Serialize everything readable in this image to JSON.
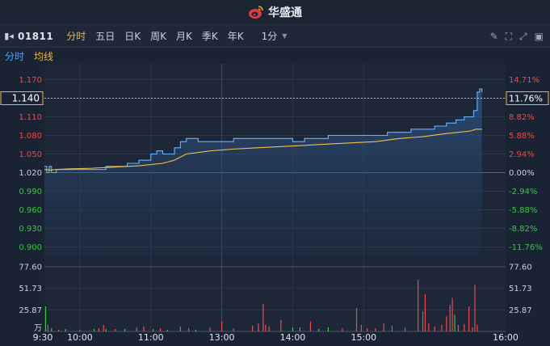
{
  "app": {
    "brand": "华盛通"
  },
  "toolbar": {
    "code": "01811",
    "tabs": [
      "分时",
      "五日",
      "日K",
      "周K",
      "月K",
      "季K",
      "年K"
    ],
    "active_tab": "分时",
    "period": "1分"
  },
  "subbar": {
    "timeshare": "分时",
    "avg_line": "均线"
  },
  "colors": {
    "up": "#e84c4c",
    "down": "#3ec24a",
    "price_line": "#69b4ff",
    "avg_line": "#f0c24b",
    "accent": "#f0b53f"
  },
  "chart_data": {
    "type": "line",
    "title": "",
    "current_price_label": "1.140",
    "current_pct_label": "11.76%",
    "prev_close": 1.02,
    "price_ticks": [
      "1.170",
      "1.140",
      "1.110",
      "1.080",
      "1.050",
      "1.020",
      "0.990",
      "0.960",
      "0.930",
      "0.900"
    ],
    "pct_ticks": [
      "14.71%",
      "11.76%",
      "8.82%",
      "5.88%",
      "2.94%",
      "0.00%",
      "-2.94%",
      "-5.88%",
      "-8.82%",
      "-11.76%"
    ],
    "volume_ticks": [
      "77.60",
      "51.73",
      "25.87"
    ],
    "volume_unit": "万",
    "time_ticks": [
      "9:30",
      "10:00",
      "11:00",
      "13:00",
      "14:00",
      "15:00",
      "16:00"
    ],
    "ylim": [
      0.885,
      1.185
    ],
    "price_series": {
      "name": "分时",
      "t": [
        0,
        2,
        4,
        6,
        10,
        15,
        20,
        30,
        40,
        50,
        52,
        60,
        66,
        70,
        80,
        90,
        95,
        100,
        110,
        115,
        120,
        130,
        140,
        150,
        160,
        170,
        185,
        195,
        205,
        210,
        220,
        240,
        250,
        260,
        270,
        280,
        290,
        300,
        310,
        320,
        330,
        335,
        340,
        348,
        355,
        360,
        363,
        366,
        368,
        370
      ],
      "values": [
        1.03,
        1.02,
        1.03,
        1.02,
        1.025,
        1.025,
        1.025,
        1.025,
        1.025,
        1.025,
        1.03,
        1.03,
        1.03,
        1.035,
        1.04,
        1.05,
        1.055,
        1.05,
        1.06,
        1.07,
        1.075,
        1.07,
        1.07,
        1.07,
        1.075,
        1.075,
        1.075,
        1.075,
        1.075,
        1.07,
        1.075,
        1.08,
        1.08,
        1.08,
        1.08,
        1.08,
        1.085,
        1.085,
        1.09,
        1.09,
        1.095,
        1.095,
        1.1,
        1.105,
        1.11,
        1.11,
        1.12,
        1.15,
        1.155,
        1.15
      ]
    },
    "avg_series": {
      "name": "均线",
      "t": [
        0,
        5,
        10,
        20,
        40,
        60,
        80,
        100,
        110,
        120,
        140,
        160,
        180,
        200,
        220,
        240,
        260,
        280,
        300,
        320,
        340,
        360,
        365,
        370
      ],
      "values": [
        1.025,
        1.024,
        1.025,
        1.026,
        1.027,
        1.029,
        1.031,
        1.035,
        1.04,
        1.05,
        1.055,
        1.058,
        1.06,
        1.062,
        1.064,
        1.066,
        1.068,
        1.07,
        1.075,
        1.078,
        1.083,
        1.087,
        1.09,
        1.09
      ]
    },
    "volume_max": 77.6,
    "volume_bars": [
      {
        "t": 1,
        "v": 30,
        "up": false
      },
      {
        "t": 3,
        "v": 8,
        "up": true
      },
      {
        "t": 6,
        "v": 4,
        "up": false
      },
      {
        "t": 12,
        "v": 2,
        "up": true
      },
      {
        "t": 18,
        "v": 3,
        "up": false
      },
      {
        "t": 30,
        "v": 2,
        "up": true
      },
      {
        "t": 42,
        "v": 3,
        "up": false
      },
      {
        "t": 46,
        "v": 4,
        "up": true
      },
      {
        "t": 50,
        "v": 8,
        "up": true
      },
      {
        "t": 52,
        "v": 3,
        "up": false
      },
      {
        "t": 60,
        "v": 3,
        "up": true
      },
      {
        "t": 68,
        "v": 3,
        "up": false
      },
      {
        "t": 78,
        "v": 5,
        "up": true
      },
      {
        "t": 84,
        "v": 6,
        "up": true
      },
      {
        "t": 92,
        "v": 3,
        "up": false
      },
      {
        "t": 98,
        "v": 4,
        "up": true
      },
      {
        "t": 104,
        "v": 2,
        "up": false
      },
      {
        "t": 115,
        "v": 6,
        "up": true
      },
      {
        "t": 122,
        "v": 4,
        "up": true
      },
      {
        "t": 128,
        "v": 2,
        "up": false
      },
      {
        "t": 140,
        "v": 5,
        "up": true
      },
      {
        "t": 150,
        "v": 12,
        "up": true
      },
      {
        "t": 160,
        "v": 4,
        "up": true
      },
      {
        "t": 176,
        "v": 7,
        "up": true
      },
      {
        "t": 181,
        "v": 10,
        "up": true
      },
      {
        "t": 185,
        "v": 33,
        "up": true
      },
      {
        "t": 187,
        "v": 8,
        "up": true
      },
      {
        "t": 190,
        "v": 6,
        "up": true
      },
      {
        "t": 200,
        "v": 14,
        "up": true
      },
      {
        "t": 210,
        "v": 5,
        "up": false
      },
      {
        "t": 216,
        "v": 5,
        "up": false
      },
      {
        "t": 225,
        "v": 12,
        "up": true
      },
      {
        "t": 232,
        "v": 3,
        "up": false
      },
      {
        "t": 240,
        "v": 5,
        "up": false
      },
      {
        "t": 252,
        "v": 4,
        "up": true
      },
      {
        "t": 264,
        "v": 28,
        "up": true
      },
      {
        "t": 268,
        "v": 8,
        "up": true
      },
      {
        "t": 273,
        "v": 4,
        "up": true
      },
      {
        "t": 280,
        "v": 4,
        "up": true
      },
      {
        "t": 287,
        "v": 10,
        "up": true
      },
      {
        "t": 294,
        "v": 7,
        "up": true
      },
      {
        "t": 305,
        "v": 5,
        "up": true
      },
      {
        "t": 316,
        "v": 62,
        "up": true
      },
      {
        "t": 320,
        "v": 24,
        "up": true
      },
      {
        "t": 322,
        "v": 45,
        "up": true
      },
      {
        "t": 325,
        "v": 10,
        "up": true
      },
      {
        "t": 330,
        "v": 6,
        "up": true
      },
      {
        "t": 336,
        "v": 8,
        "up": true
      },
      {
        "t": 340,
        "v": 18,
        "up": true
      },
      {
        "t": 343,
        "v": 32,
        "up": true
      },
      {
        "t": 345,
        "v": 40,
        "up": true
      },
      {
        "t": 347,
        "v": 20,
        "up": false
      },
      {
        "t": 350,
        "v": 8,
        "up": true
      },
      {
        "t": 355,
        "v": 9,
        "up": true
      },
      {
        "t": 359,
        "v": 30,
        "up": true
      },
      {
        "t": 362,
        "v": 5,
        "up": true
      },
      {
        "t": 364,
        "v": 56,
        "up": true
      },
      {
        "t": 366,
        "v": 8,
        "up": true
      }
    ]
  }
}
